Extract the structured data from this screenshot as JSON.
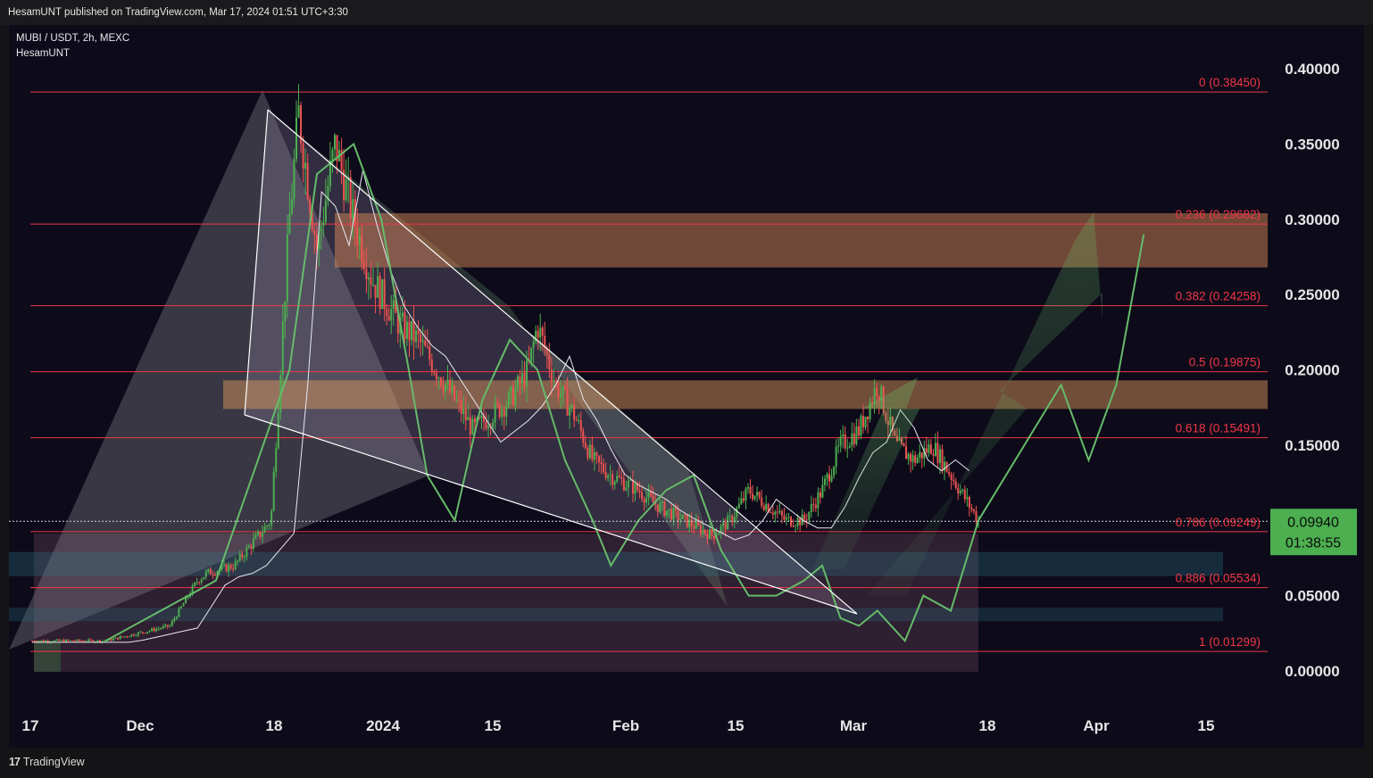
{
  "header": {
    "publish_info": "HesamUNT published on TradingView.com, Mar 17, 2024 01:51 UTC+3:30"
  },
  "footer": {
    "brand": "TradingView",
    "logo_glyph": "17"
  },
  "chart_data": {
    "type": "candlestick",
    "symbol": "MUBI / USDT, 2h, MEXC",
    "author": "HesamUNT",
    "y_ticks": [
      "0.40000",
      "0.35000",
      "0.30000",
      "0.25000",
      "0.20000",
      "0.15000",
      "0.05000",
      "0.00000"
    ],
    "x_ticks": [
      "17",
      "Dec",
      "18",
      "2024",
      "15",
      "Feb",
      "15",
      "Mar",
      "18",
      "Apr",
      "15"
    ],
    "ylim": [
      0,
      0.4
    ],
    "last_price": {
      "value": "0.09940",
      "countdown": "01:38:55"
    },
    "fib_levels": [
      {
        "ratio": 0,
        "label": "0 (0.38450)",
        "value": 0.3845
      },
      {
        "ratio": 0.236,
        "label": "0.236 (0.29682)",
        "value": 0.29682
      },
      {
        "ratio": 0.382,
        "label": "0.382 (0.24258)",
        "value": 0.24258
      },
      {
        "ratio": 0.5,
        "label": "0.5 (0.19875)",
        "value": 0.19875
      },
      {
        "ratio": 0.618,
        "label": "0.618 (0.15491)",
        "value": 0.15491
      },
      {
        "ratio": 0.786,
        "label": "0.786 (0.09249)",
        "value": 0.09249
      },
      {
        "ratio": 0.886,
        "label": "0.886 (0.05534)",
        "value": 0.05534
      },
      {
        "ratio": 1,
        "label": "1 (0.01299)",
        "value": 0.01299
      }
    ],
    "zones": [
      {
        "name": "upper-resistance-zone",
        "from": 0.268,
        "to": 0.304,
        "color": "#e8925a"
      },
      {
        "name": "mid-resistance-zone",
        "from": 0.174,
        "to": 0.193,
        "color": "#e8a060"
      },
      {
        "name": "support-zone-1",
        "from": 0.063,
        "to": 0.079,
        "color": "#2a7a8a"
      },
      {
        "name": "support-zone-2",
        "from": 0.033,
        "to": 0.042,
        "color": "#2a6a7a"
      }
    ],
    "price_path": [
      [
        0,
        0.02
      ],
      [
        8,
        0.02
      ],
      [
        15,
        0.03
      ],
      [
        18,
        0.06
      ],
      [
        19,
        0.065
      ],
      [
        22,
        0.07
      ],
      [
        26,
        0.1
      ],
      [
        28,
        0.3
      ],
      [
        29,
        0.37
      ],
      [
        31,
        0.28
      ],
      [
        33,
        0.35
      ],
      [
        35,
        0.3
      ],
      [
        37,
        0.26
      ],
      [
        40,
        0.23
      ],
      [
        42,
        0.22
      ],
      [
        44,
        0.2
      ],
      [
        46,
        0.18
      ],
      [
        48,
        0.16
      ],
      [
        50,
        0.17
      ],
      [
        52,
        0.18
      ],
      [
        54,
        0.2
      ],
      [
        55,
        0.23
      ],
      [
        57,
        0.19
      ],
      [
        59,
        0.17
      ],
      [
        61,
        0.14
      ],
      [
        63,
        0.13
      ],
      [
        66,
        0.12
      ],
      [
        68,
        0.11
      ],
      [
        71,
        0.1
      ],
      [
        74,
        0.09
      ],
      [
        76,
        0.1
      ],
      [
        78,
        0.12
      ],
      [
        80,
        0.11
      ],
      [
        82,
        0.1
      ],
      [
        84,
        0.1
      ],
      [
        86,
        0.12
      ],
      [
        88,
        0.15
      ],
      [
        90,
        0.16
      ],
      [
        92,
        0.19
      ],
      [
        94,
        0.15
      ],
      [
        96,
        0.14
      ],
      [
        98,
        0.15
      ],
      [
        100,
        0.13
      ],
      [
        103,
        0.1
      ]
    ],
    "projection_path": [
      [
        103,
        0.1
      ],
      [
        108,
        0.15
      ],
      [
        112,
        0.19
      ],
      [
        115,
        0.14
      ],
      [
        118,
        0.19
      ],
      [
        121,
        0.29
      ]
    ],
    "colors": {
      "up": "#4caf50",
      "down": "#ef5350",
      "fib": "#f23645",
      "projection": "#66bb6a",
      "last_price": "#4caf50"
    }
  }
}
